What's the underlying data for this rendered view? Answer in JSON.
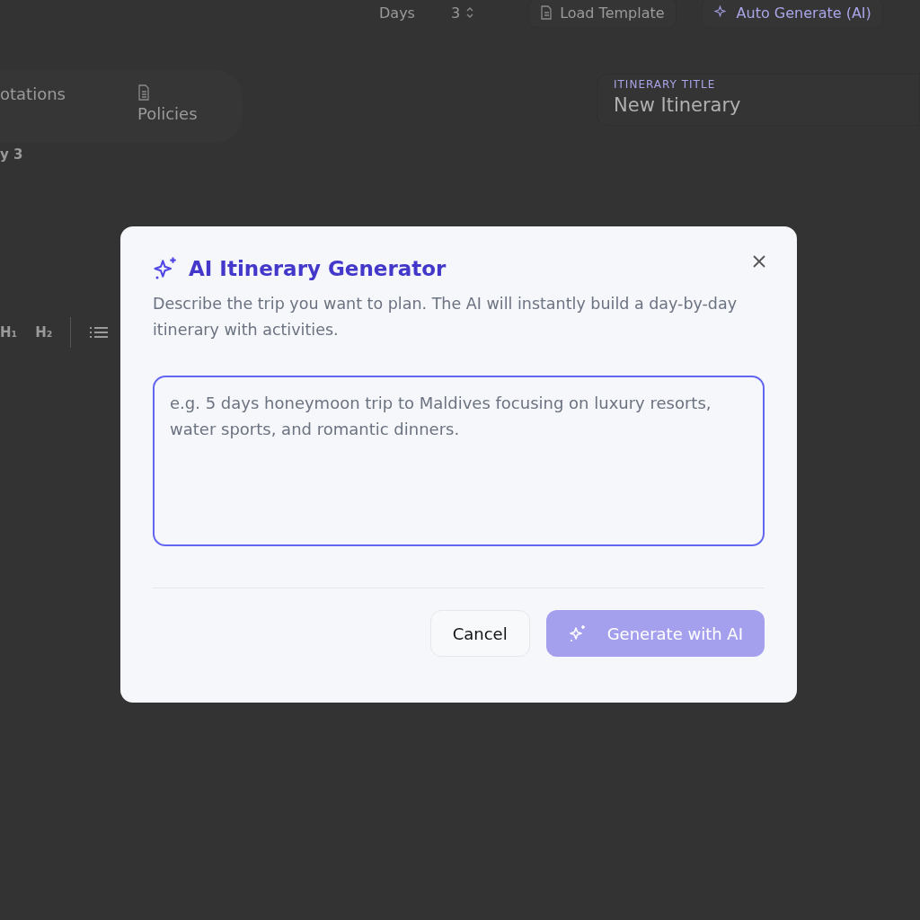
{
  "toolbar": {
    "days_label": "Days",
    "days_value": "3",
    "load_template": "Load Template",
    "auto_generate": "Auto Generate (AI)"
  },
  "tabs": [
    {
      "label": "otations",
      "selected": false
    },
    {
      "label": "Policies",
      "selected": false
    }
  ],
  "day_label": "y 3",
  "editor_toolbar": [
    "H₁",
    "H₂"
  ],
  "title_field": {
    "label": "ITINERARY TITLE",
    "value": "New Itinerary"
  },
  "dialog": {
    "title": "AI Itinerary Generator",
    "description": "Describe the trip you want to plan. The AI will instantly build a day-by-day itinerary with activities.",
    "prompt": {
      "placeholder": "e.g. 5 days honeymoon trip to Maldives focusing on luxury resorts, water sports, and romantic dinners."
    },
    "cancel": "Cancel",
    "generate": {
      "label": "Generate with AI",
      "disabled": true
    }
  }
}
